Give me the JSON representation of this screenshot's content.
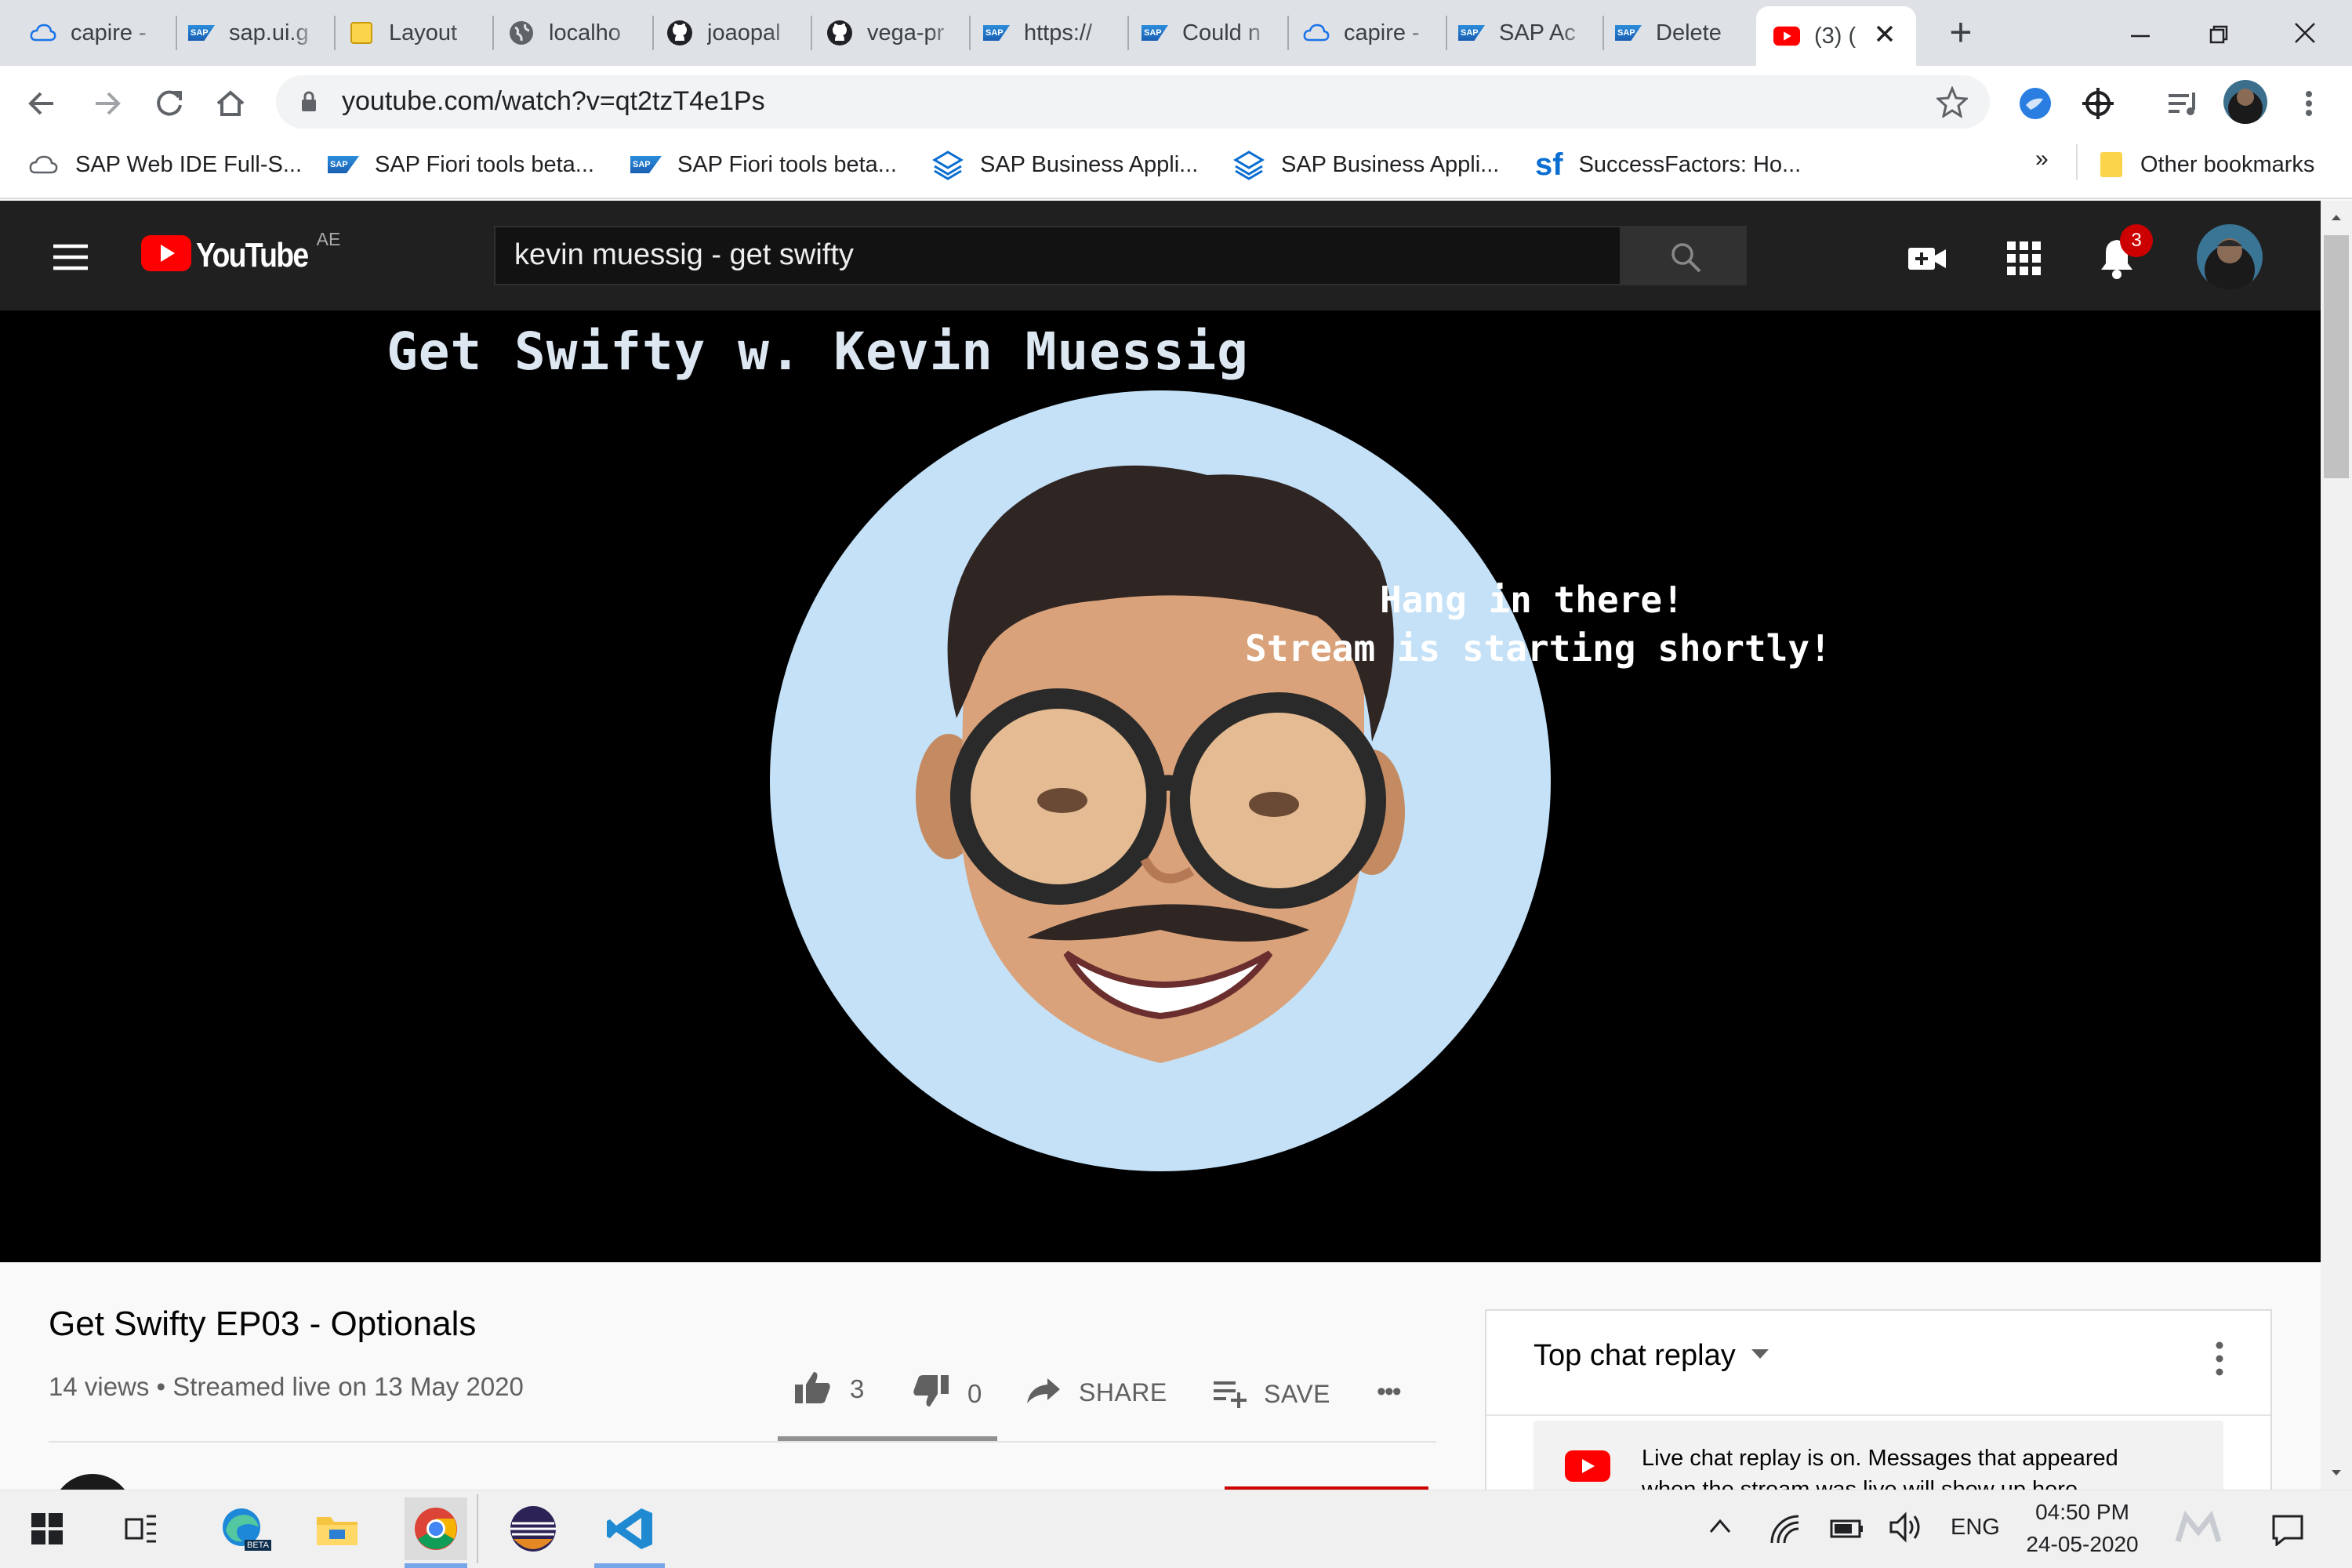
{
  "browser": {
    "tabs": [
      {
        "title": "capire - ",
        "icon": "cloud-icon"
      },
      {
        "title": "sap.ui.g",
        "icon": "sap-icon"
      },
      {
        "title": "Layout",
        "icon": "folder-icon"
      },
      {
        "title": "localho",
        "icon": "globe-icon"
      },
      {
        "title": "joaopal",
        "icon": "github-icon"
      },
      {
        "title": "vega-pr",
        "icon": "github-icon"
      },
      {
        "title": "https://",
        "icon": "sap-icon"
      },
      {
        "title": "Could n",
        "icon": "sap-icon"
      },
      {
        "title": "capire - ",
        "icon": "cloud-icon"
      },
      {
        "title": "SAP Ac",
        "icon": "sap-icon"
      },
      {
        "title": "Delete",
        "icon": "sap-icon"
      },
      {
        "title": "(3) (",
        "icon": "youtube-icon",
        "active": true
      }
    ],
    "new_tab_label": "+",
    "url": "youtube.com/watch?v=qt2tzT4e1Ps",
    "bookmarks": [
      {
        "label": "SAP Web IDE Full-S...",
        "icon": "cloud-icon"
      },
      {
        "label": "SAP Fiori tools beta...",
        "icon": "sap-icon"
      },
      {
        "label": "SAP Fiori tools beta...",
        "icon": "sap-icon"
      },
      {
        "label": "SAP Business Appli...",
        "icon": "bas-icon"
      },
      {
        "label": "SAP Business Appli...",
        "icon": "bas-icon"
      },
      {
        "label": "SuccessFactors: Ho...",
        "icon": "successfactors-icon"
      }
    ],
    "more_bookmarks": "»",
    "other_bookmarks": "Other bookmarks"
  },
  "youtube": {
    "logo_text": "YouTube",
    "region": "AE",
    "search_value": "kevin muessig - get swifty",
    "notification_count": "3",
    "video": {
      "overlay_title": "Get Swifty w. Kevin Muessig",
      "overlay_line1": "Hang in there!",
      "overlay_line2": "Stream is starting shortly!"
    },
    "title": "Get Swifty EP03 - Optionals",
    "meta": "14 views • Streamed live on 13 May 2020",
    "likes": "3",
    "dislikes": "0",
    "share_label": "SHARE",
    "save_label": "SAVE",
    "more_label": "•••",
    "chat": {
      "header": "Top chat replay",
      "notice_line1": "Live chat replay is on. Messages that appeared",
      "notice_line2": "when the stream was live will show up here."
    }
  },
  "taskbar": {
    "language": "ENG",
    "time": "04:50 PM",
    "date": "24-05-2020",
    "edge_badge": "BETA"
  },
  "colors": {
    "youtube_red": "#ff0000",
    "masthead": "#202020",
    "avatar_bg": "#c4e1f7"
  }
}
